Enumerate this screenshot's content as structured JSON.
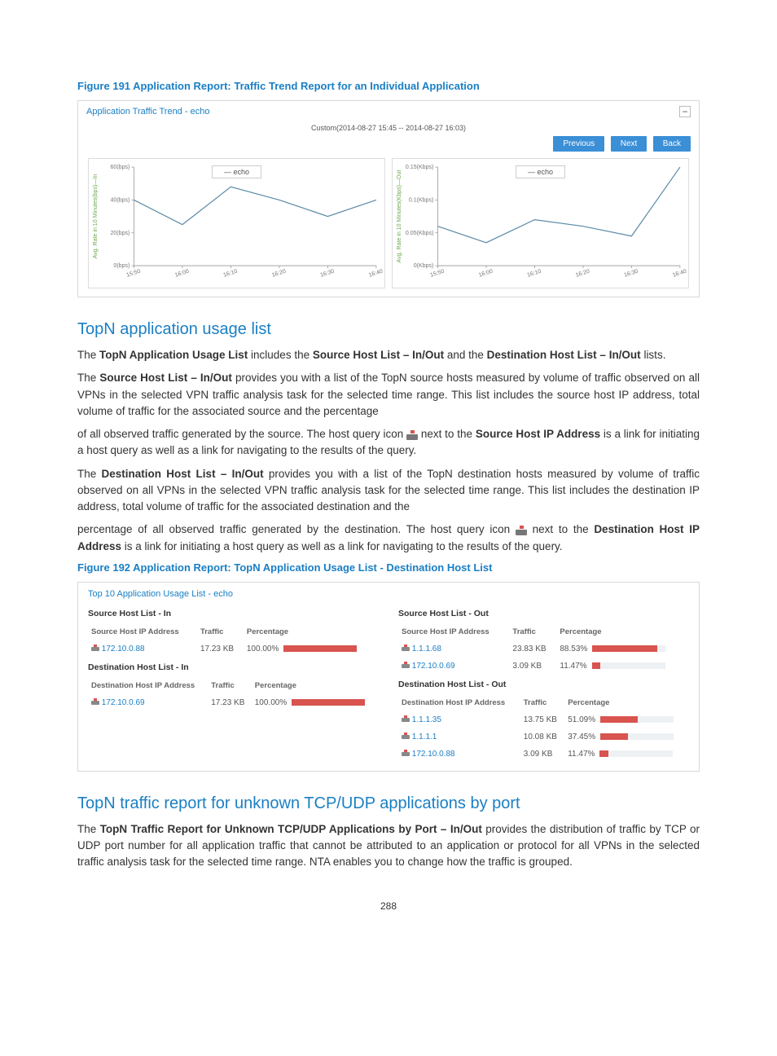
{
  "figure191": {
    "caption": "Figure 191 Application Report: Traffic Trend Report for an Individual Application",
    "panel_title": "Application Traffic Trend - echo",
    "subtitle": "Custom(2014-08-27 15:45 -- 2014-08-27 16:03)",
    "buttons": {
      "previous": "Previous",
      "next": "Next",
      "back": "Back"
    },
    "collapse_glyph": "−",
    "legend": "— echo"
  },
  "chart_data": [
    {
      "type": "line",
      "title": "In",
      "ylabel": "Avg. Rate in 10 Minutes(bps)—In",
      "x_ticks": [
        "15:50",
        "16:00",
        "16:10",
        "16:20",
        "16:30",
        "16:40"
      ],
      "y_ticks": [
        "0(bps)",
        "20(bps)",
        "40(bps)",
        "60(bps)"
      ],
      "ylim": [
        0,
        60
      ],
      "series": [
        {
          "name": "echo",
          "x": [
            "15:50",
            "16:00",
            "16:10",
            "16:20",
            "16:30",
            "16:40"
          ],
          "values": [
            40,
            25,
            48,
            40,
            30,
            40
          ]
        }
      ]
    },
    {
      "type": "line",
      "title": "Out",
      "ylabel": "Avg. Rate in 10 Minutes(Kbps)—Out",
      "x_ticks": [
        "15:50",
        "16:00",
        "16:10",
        "16:20",
        "16:30",
        "16:40"
      ],
      "y_ticks": [
        "0(Kbps)",
        "0.05(Kbps)",
        "0.1(Kbps)",
        "0.15(Kbps)"
      ],
      "ylim": [
        0,
        0.15
      ],
      "series": [
        {
          "name": "echo",
          "x": [
            "15:50",
            "16:00",
            "16:10",
            "16:20",
            "16:30",
            "16:40"
          ],
          "values": [
            0.06,
            0.035,
            0.07,
            0.06,
            0.045,
            0.15
          ]
        }
      ]
    }
  ],
  "sections": {
    "topn_app": {
      "heading": "TopN application usage list",
      "p1_a": "The ",
      "p1_b": "TopN Application Usage List",
      "p1_c": " includes the ",
      "p1_d": "Source Host List – In/Out",
      "p1_e": " and the ",
      "p1_f": "Destination Host List – In/Out",
      "p1_g": " lists.",
      "p2_a": "The ",
      "p2_b": "Source Host List – In/Out",
      "p2_c": " provides you with a list of the TopN source hosts measured by volume of traffic observed on all VPNs in the selected VPN traffic analysis task for the selected time range. This list includes the source host IP address, total volume of traffic for the associated source and the percentage",
      "p3_a": "of all observed traffic generated by the source. The host query icon ",
      "p3_b": " next to the ",
      "p3_c": "Source Host IP Address",
      "p3_d": " is a link for initiating a host query as well as a link for navigating to the results of the query.",
      "p4_a": "The ",
      "p4_b": "Destination Host List – In/Out",
      "p4_c": " provides you with a list of the TopN destination hosts measured by volume of traffic observed on all VPNs in the selected VPN traffic analysis task for the selected time range. This list includes the destination IP address, total volume of traffic for the associated destination and the",
      "p5_a": "percentage of all observed traffic generated by the destination. The host query icon ",
      "p5_b": " next to the ",
      "p5_c": "Destination Host IP Address",
      "p5_d": " is a link for initiating a host query as well as a link for navigating to the results of the query."
    },
    "topn_tcp": {
      "heading": "TopN traffic report for unknown TCP/UDP applications by port",
      "p_a": "The ",
      "p_b": "TopN Traffic Report for Unknown TCP/UDP Applications by Port – In/Out",
      "p_c": " provides the distribution of traffic by TCP or UDP port number for all application traffic that cannot be attributed to an application or protocol for all VPNs in the selected traffic analysis task for the selected time range. NTA enables you to change how the traffic is grouped."
    }
  },
  "figure192": {
    "caption": "Figure 192 Application Report: TopN Application Usage List - Destination Host List",
    "panel_title": "Top 10 Application Usage List - echo",
    "cols": {
      "src_ip": "Source Host IP Address",
      "dst_ip": "Destination Host IP Address",
      "traffic": "Traffic",
      "percentage": "Percentage"
    },
    "titles": {
      "src_in": "Source Host List - In",
      "src_out": "Source Host List - Out",
      "dst_in": "Destination Host List - In",
      "dst_out": "Destination Host List - Out"
    },
    "src_in": [
      {
        "ip": "172.10.0.88",
        "traffic": "17.23 KB",
        "pct": "100.00%",
        "pct_num": 100
      }
    ],
    "dst_in": [
      {
        "ip": "172.10.0.69",
        "traffic": "17.23 KB",
        "pct": "100.00%",
        "pct_num": 100
      }
    ],
    "src_out": [
      {
        "ip": "1.1.1.68",
        "traffic": "23.83 KB",
        "pct": "88.53%",
        "pct_num": 88.53
      },
      {
        "ip": "172.10.0.69",
        "traffic": "3.09 KB",
        "pct": "11.47%",
        "pct_num": 11.47
      }
    ],
    "dst_out": [
      {
        "ip": "1.1.1.35",
        "traffic": "13.75 KB",
        "pct": "51.09%",
        "pct_num": 51.09
      },
      {
        "ip": "1.1.1.1",
        "traffic": "10.08 KB",
        "pct": "37.45%",
        "pct_num": 37.45
      },
      {
        "ip": "172.10.0.88",
        "traffic": "3.09 KB",
        "pct": "11.47%",
        "pct_num": 11.47
      }
    ]
  },
  "page_number": "288"
}
